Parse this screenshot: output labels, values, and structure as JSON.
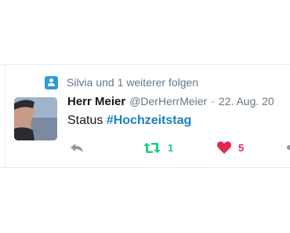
{
  "context": {
    "text": "Silvia und 1 weiterer folgen",
    "icon": "follow-person-icon"
  },
  "tweet": {
    "author_name": "Herr Meier",
    "handle": "@DerHerrMeier",
    "separator": "·",
    "date": "22. Aug. 20",
    "text_prefix": "Status",
    "hashtag": "#Hochzeitstag"
  },
  "actions": {
    "reply_icon": "reply-icon",
    "retweet_icon": "retweet-icon",
    "retweet_count": "1",
    "like_icon": "heart-icon",
    "like_count": "5"
  },
  "colors": {
    "accent": "#1b7fbd",
    "retweet": "#19cf86",
    "like": "#e2264d",
    "muted": "#657786",
    "text": "#14171a"
  }
}
